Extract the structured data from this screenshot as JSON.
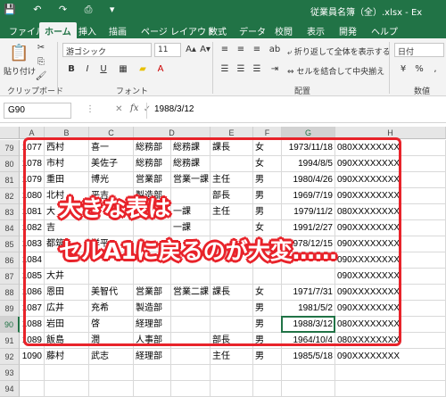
{
  "window": {
    "quick_access": "💾 ↶ ↷ ⎙ ▾",
    "title": "従業員名簿（全）.xlsx - Ex"
  },
  "ribbon_tabs": [
    "ファイル",
    "ホーム",
    "挿入",
    "描画",
    "ページ レイアウト",
    "数式",
    "データ",
    "校閲",
    "表示",
    "開発",
    "ヘルプ"
  ],
  "ribbon": {
    "paste_label": "貼り付け",
    "font_name": "游ゴシック",
    "font_size": "11",
    "wrap_text": "折り返して全体を表示する",
    "merge_center": "セルを結合して中央揃え",
    "number_format": "日付",
    "groups": {
      "clipboard": "クリップボード",
      "font": "フォント",
      "alignment": "配置",
      "number": "数値"
    }
  },
  "formula_bar": {
    "name_box": "G90",
    "fx": "fx",
    "controls": "⋮ ✕ ✓",
    "value": "1988/3/12"
  },
  "columns": [
    "A",
    "B",
    "C",
    "D",
    "E",
    "F",
    "G",
    "H"
  ],
  "selected_column": "G",
  "selected_row": "90",
  "rows": [
    {
      "row": "79",
      "cells": [
        "1077",
        "西村",
        "喜一",
        "総務部",
        "総務課",
        "課長",
        "女",
        "1973/11/18",
        "080XXXXXXXX"
      ]
    },
    {
      "row": "80",
      "cells": [
        "1078",
        "市村",
        "美佐子",
        "総務部",
        "総務課",
        "",
        "女",
        "1994/8/5",
        "090XXXXXXXX"
      ]
    },
    {
      "row": "81",
      "cells": [
        "1079",
        "重田",
        "博光",
        "営業部",
        "営業一課",
        "主任",
        "男",
        "1980/4/26",
        "090XXXXXXXX"
      ]
    },
    {
      "row": "82",
      "cells": [
        "1080",
        "北村",
        "平吉",
        "製造部",
        "",
        "部長",
        "男",
        "1969/7/19",
        "090XXXXXXXX"
      ]
    },
    {
      "row": "83",
      "cells": [
        "1081",
        "大",
        "",
        "",
        "一課",
        "主任",
        "男",
        "1979/11/2",
        "080XXXXXXXX"
      ]
    },
    {
      "row": "84",
      "cells": [
        "1082",
        "吉",
        "",
        "",
        "一課",
        "",
        "女",
        "1991/2/27",
        "090XXXXXXXX"
      ]
    },
    {
      "row": "85",
      "cells": [
        "1083",
        "都筑",
        "洋平",
        "",
        "",
        "",
        "男",
        "1978/12/15",
        "090XXXXXXXX"
      ]
    },
    {
      "row": "86",
      "cells": [
        "1084",
        "",
        "",
        "",
        "",
        "",
        "",
        "",
        "090XXXXXXXX"
      ]
    },
    {
      "row": "87",
      "cells": [
        "1085",
        "大井",
        "",
        "",
        "",
        "",
        "",
        "",
        "090XXXXXXXX"
      ]
    },
    {
      "row": "88",
      "cells": [
        "1086",
        "恩田",
        "美智代",
        "営業部",
        "営業二課",
        "課長",
        "女",
        "1971/7/31",
        "090XXXXXXXX"
      ]
    },
    {
      "row": "89",
      "cells": [
        "1087",
        "広井",
        "充希",
        "製造部",
        "",
        "",
        "男",
        "1981/5/2",
        "090XXXXXXXX"
      ]
    },
    {
      "row": "90",
      "cells": [
        "1088",
        "岩田",
        "啓",
        "経理部",
        "",
        "",
        "男",
        "1988/3/12",
        "080XXXXXXXX"
      ]
    },
    {
      "row": "91",
      "cells": [
        "1089",
        "飯島",
        "潤",
        "人事部",
        "",
        "部長",
        "男",
        "1964/10/4",
        "080XXXXXXXX"
      ]
    },
    {
      "row": "92",
      "cells": [
        "1090",
        "藤村",
        "武志",
        "経理部",
        "",
        "主任",
        "男",
        "1985/5/18",
        "090XXXXXXXX"
      ]
    },
    {
      "row": "93",
      "cells": [
        "",
        "",
        "",
        "",
        "",
        "",
        "",
        "",
        ""
      ]
    },
    {
      "row": "94",
      "cells": [
        "",
        "",
        "",
        "",
        "",
        "",
        "",
        "",
        ""
      ]
    }
  ],
  "overlay": {
    "line1": "大きな表は",
    "line2": "セルA1に戻るのが大変……",
    "frame_color": "#e8232a"
  },
  "colors": {
    "excel_green": "#217346"
  }
}
